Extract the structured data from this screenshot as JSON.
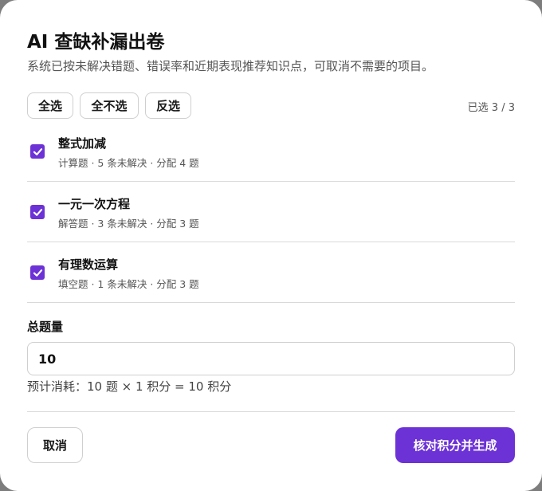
{
  "dialog": {
    "title": "AI 查缺补漏出卷",
    "subtitle": "系统已按未解决错题、错误率和近期表现推荐知识点，可取消不需要的项目。"
  },
  "selection": {
    "select_all_label": "全选",
    "select_none_label": "全不选",
    "invert_label": "反选",
    "selected_count": "已选 3 / 3"
  },
  "items": [
    {
      "name": "整式加减",
      "meta": "计算题 · 5 条未解决 · 分配 4 题",
      "checked": true
    },
    {
      "name": "一元一次方程",
      "meta": "解答题 · 3 条未解决 · 分配 3 题",
      "checked": true
    },
    {
      "name": "有理数运算",
      "meta": "填空题 · 1 条未解决 · 分配 3 题",
      "checked": true
    }
  ],
  "total": {
    "label": "总题量",
    "value": "10",
    "cost_line": "预计消耗：10 题 × 1 积分 = 10 积分"
  },
  "footer": {
    "cancel_label": "取消",
    "confirm_label": "核对积分并生成"
  },
  "colors": {
    "accent": "#6c32d6",
    "overlay": "#7d7d7d"
  },
  "icons": {
    "checkbox_checked": "check-icon"
  }
}
